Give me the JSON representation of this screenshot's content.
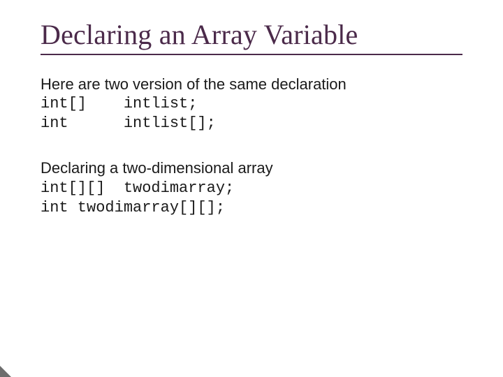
{
  "title": "Declaring an Array Variable",
  "section1": {
    "intro": "Here are two version of the same declaration",
    "line1": "int[]    intlist;",
    "line2": "int      intlist[];"
  },
  "section2": {
    "intro": "Declaring a two-dimensional array",
    "line1": "int[][]  twodimarray;",
    "line2": "int twodimarray[][];"
  }
}
